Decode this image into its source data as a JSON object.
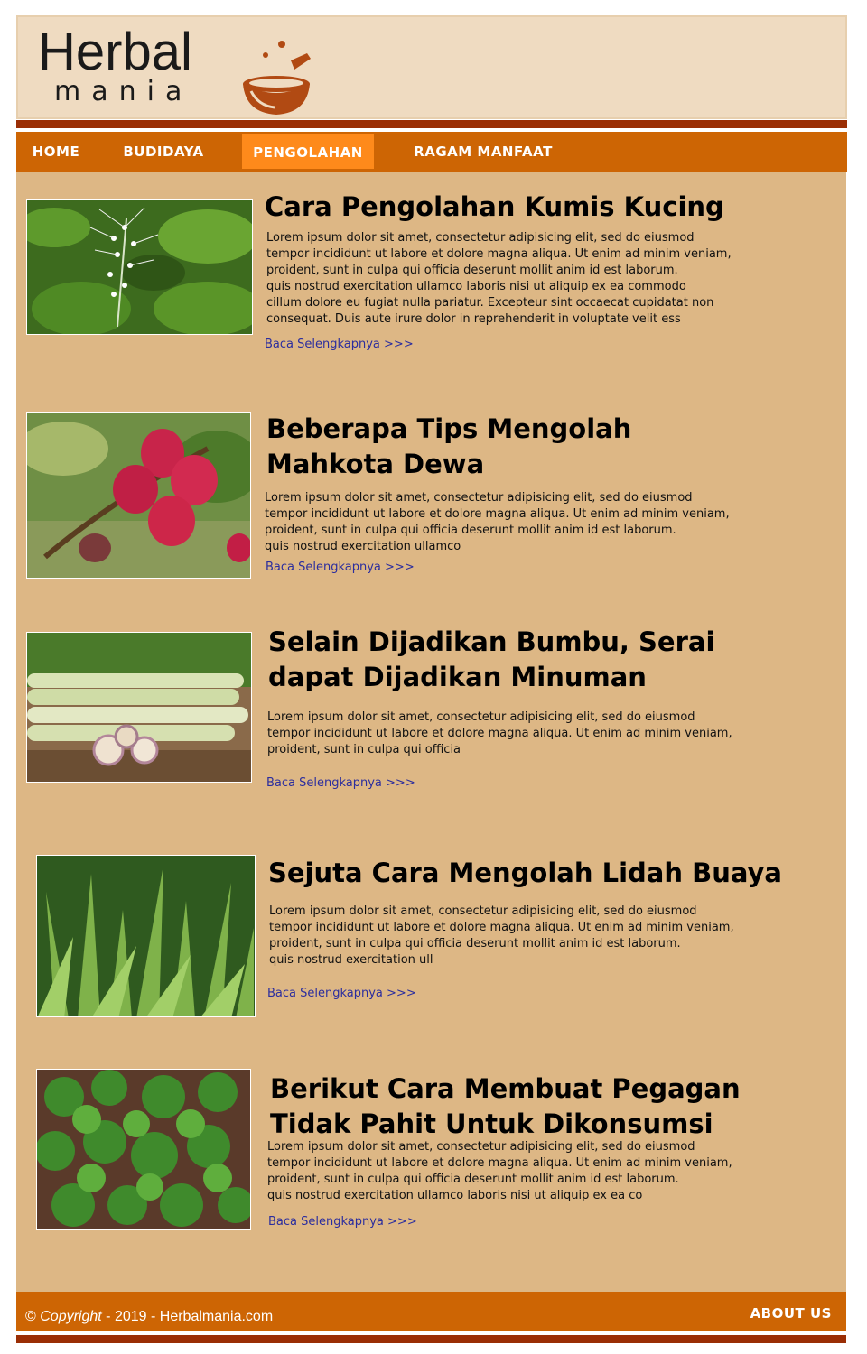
{
  "logo": {
    "line1": "Herbal",
    "line2": "mania"
  },
  "nav": {
    "items": [
      {
        "label": "HOME",
        "active": false
      },
      {
        "label": "BUDIDAYA",
        "active": false
      },
      {
        "label": "PENGOLAHAN",
        "active": true
      },
      {
        "label": "RAGAM MANFAAT",
        "active": false
      }
    ]
  },
  "articles": [
    {
      "title": "Cara Pengolahan Kumis Kucing",
      "body": "Lorem ipsum dolor sit amet, consectetur adipisicing elit, sed do eiusmod\ntempor incididunt ut labore et dolore magna aliqua. Ut enim ad minim veniam,\nproident, sunt in culpa qui officia deserunt mollit anim id est laborum.\nquis nostrud exercitation ullamco laboris nisi ut aliquip ex ea commodo\ncillum dolore eu fugiat nulla pariatur. Excepteur sint occaecat cupidatat non\nconsequat. Duis aute irure dolor in reprehenderit in voluptate velit ess",
      "read_more": "Baca Selengkapnya >>>",
      "image_icon": "kumis-kucing-photo"
    },
    {
      "title": "Beberapa Tips Mengolah\nMahkota Dewa",
      "body": "Lorem ipsum dolor sit amet, consectetur adipisicing elit, sed do eiusmod\ntempor incididunt ut labore et dolore magna aliqua. Ut enim ad minim veniam,\nproident, sunt in culpa qui officia deserunt mollit anim id est laborum.\nquis nostrud exercitation ullamco",
      "read_more": "Baca Selengkapnya >>>",
      "image_icon": "mahkota-dewa-photo"
    },
    {
      "title": "Selain Dijadikan Bumbu, Serai\ndapat Dijadikan Minuman",
      "body": "Lorem ipsum dolor sit amet, consectetur adipisicing elit, sed do eiusmod\ntempor incididunt ut labore et dolore magna aliqua. Ut enim ad minim veniam,\nproident, sunt in culpa qui officia",
      "read_more": "Baca Selengkapnya >>>",
      "image_icon": "serai-photo"
    },
    {
      "title": "Sejuta Cara Mengolah Lidah Buaya",
      "body": "Lorem ipsum dolor sit amet, consectetur adipisicing elit, sed do eiusmod\ntempor incididunt ut labore et dolore magna aliqua. Ut enim ad minim veniam,\nproident, sunt in culpa qui officia deserunt mollit anim id est laborum.\nquis nostrud exercitation ull",
      "read_more": "Baca Selengkapnya >>>",
      "image_icon": "lidah-buaya-photo"
    },
    {
      "title": "Berikut Cara Membuat Pegagan\nTidak Pahit Untuk Dikonsumsi",
      "body": "Lorem ipsum dolor sit amet, consectetur adipisicing elit, sed do eiusmod\ntempor incididunt ut labore et dolore magna aliqua. Ut enim ad minim veniam,\nproident, sunt in culpa qui officia deserunt mollit anim id est laborum.\nquis nostrud exercitation ullamco laboris nisi ut aliquip ex ea co",
      "read_more": "Baca Selengkapnya >>>",
      "image_icon": "pegagan-photo"
    }
  ],
  "footer": {
    "copyright_symbol": "©",
    "copyright_word": "Copyright",
    "copyright_rest": " - 2019 - Herbalmania.com",
    "about_label": "ABOUT US"
  },
  "colors": {
    "header_bg": "#efdbc1",
    "dark_bar": "#9a2e05",
    "nav_bg": "#cd6504",
    "nav_active": "#fe8a1b",
    "content_bg": "#ddb785",
    "link": "#2b2d9e"
  }
}
